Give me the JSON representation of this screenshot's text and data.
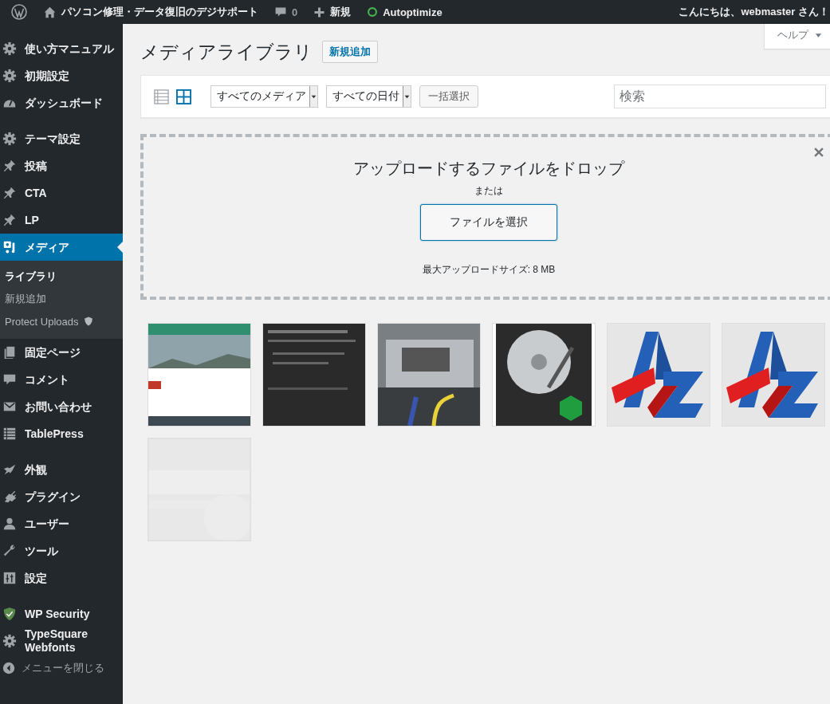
{
  "admin_bar": {
    "site_name": "パソコン修理・データ復旧のデジサポート",
    "comments": "0",
    "new": "新規",
    "plugin": "Autoptimize",
    "greeting": "こんにちは、webmaster さん！"
  },
  "sidebar": {
    "items": [
      {
        "label": "使い方マニュアル",
        "selected": false
      },
      {
        "label": "初期設定",
        "selected": false
      },
      {
        "label": "ダッシュボード",
        "selected": false
      },
      {
        "label": "テーマ設定",
        "selected": false
      },
      {
        "label": "投稿",
        "selected": false
      },
      {
        "label": "CTA",
        "selected": false
      },
      {
        "label": "LP",
        "selected": false
      },
      {
        "label": "メディア",
        "selected": true,
        "children": [
          {
            "label": "ライブラリ",
            "selected": true
          },
          {
            "label": "新規追加",
            "selected": false
          },
          {
            "label": "Protect Uploads",
            "selected": false
          }
        ]
      },
      {
        "label": "固定ページ",
        "selected": false
      },
      {
        "label": "コメント",
        "selected": false
      },
      {
        "label": "お問い合わせ",
        "selected": false
      },
      {
        "label": "TablePress",
        "selected": false
      },
      {
        "label": "外観",
        "selected": false
      },
      {
        "label": "プラグイン",
        "selected": false
      },
      {
        "label": "ユーザー",
        "selected": false
      },
      {
        "label": "ツール",
        "selected": false
      },
      {
        "label": "設定",
        "selected": false
      },
      {
        "label": "WP Security",
        "selected": false
      },
      {
        "label": "TypeSquare Webfonts",
        "selected": false
      }
    ],
    "collapse": "メニューを閉じる"
  },
  "help_tab": "ヘルプ",
  "page": {
    "title": "メディアライブラリ",
    "add_new": "新規追加"
  },
  "toolbar": {
    "view_modes": [
      {
        "selected": false
      },
      {
        "selected": true
      }
    ],
    "filters": [
      "すべてのメディア",
      "すべての日付"
    ],
    "bulk_select": "一括選択",
    "search": {
      "placeholder": "検索"
    }
  },
  "uploader": {
    "title": "アップロードするファイルをドロップ",
    "or": "または",
    "button": "ファイルを選択",
    "max_size": "最大アップロードサイズ: 8 MB"
  }
}
